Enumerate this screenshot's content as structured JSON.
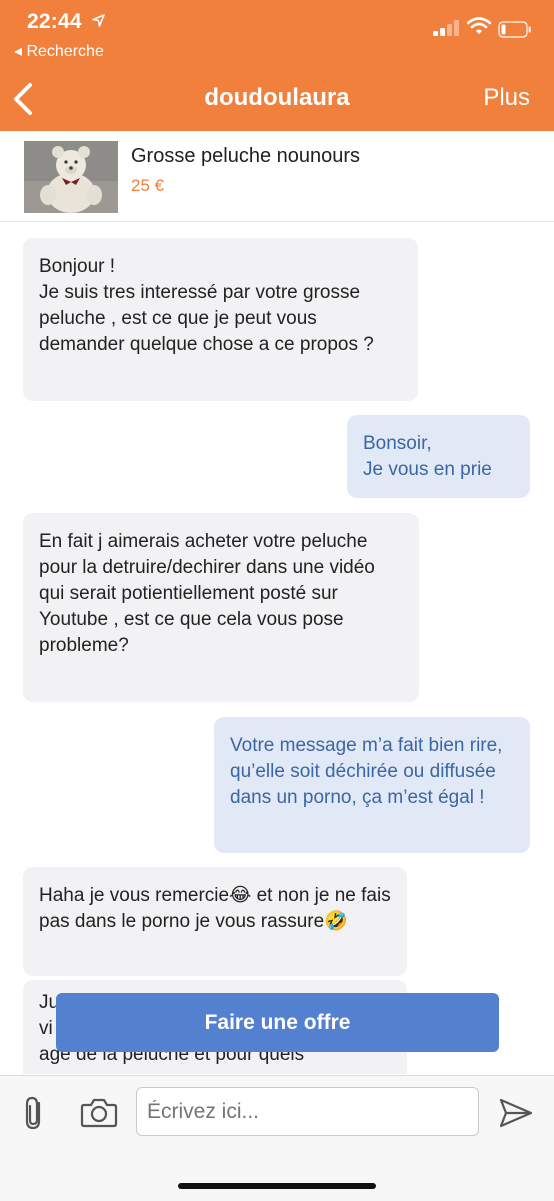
{
  "status_bar": {
    "time": "22:44",
    "back_app": "◂ Recherche"
  },
  "nav": {
    "back_icon": "chevron-left-icon",
    "title": "doudoulaura",
    "more_label": "Plus"
  },
  "product": {
    "title": "Grosse peluche nounours",
    "price": "25 €"
  },
  "messages": [
    {
      "side": "in",
      "text": "Bonjour !\nJe suis tres interessé par votre grosse peluche , est ce que je peut vous demander quelque chose a ce propos ?"
    },
    {
      "side": "out",
      "text": "Bonsoir,\nJe vous en prie"
    },
    {
      "side": "in",
      "text": "En fait j aimerais acheter votre peluche pour la detruire/dechirer dans une vidéo qui serait potientiellement posté sur Youtube , est ce que cela vous pose probleme?"
    },
    {
      "side": "out",
      "text": "Votre message m’a fait bien rire, qu’elle soit déchirée ou diffusée dans un porno, ça m’est égal !"
    },
    {
      "side": "in",
      "text": "Haha je vous remercie😂 et non je ne fais pas dans le porno je vous rassure🤣"
    },
    {
      "side": "in",
      "text": "Ju\nvi\nage de la peluche et pour quels"
    }
  ],
  "offer_button": "Faire une offre",
  "composer": {
    "placeholder": "Écrivez ici..."
  },
  "colors": {
    "brand_orange": "#f0803c",
    "offer_blue": "#5381d0",
    "out_bubble": "#e2e9f6",
    "in_bubble": "#f2f2f4"
  }
}
